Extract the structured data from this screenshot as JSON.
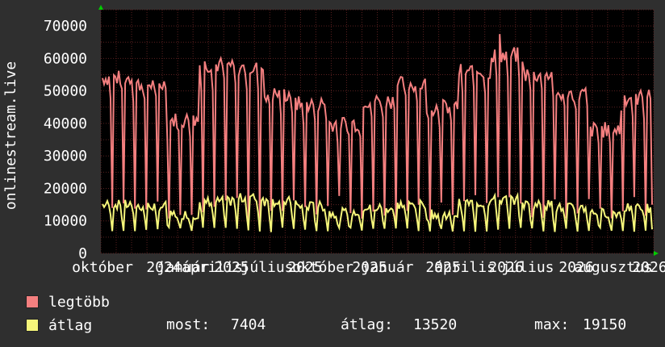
{
  "colors": {
    "background": "#2f2f2f",
    "plot_background": "#000000",
    "grid": "#5a2020",
    "series_max": "#f47f7f",
    "series_avg": "#f5f57a",
    "axis_arrow": "#00cc00",
    "text": "#ffffff"
  },
  "legend": {
    "max_label": "legtöbb",
    "avg_label": "átlag",
    "stats": {
      "now_label": "most:",
      "now_value": "7404",
      "avg_label": "átlag:",
      "avg_value": "13520",
      "max_label": "max:",
      "max_value": "19150"
    }
  },
  "chart_data": {
    "type": "line",
    "ylabel": "onlinestream.live",
    "ylim": [
      0,
      75000
    ],
    "yticks": [
      "0",
      "10000",
      "20000",
      "30000",
      "40000",
      "50000",
      "60000",
      "70000"
    ],
    "xtick_labels": [
      "október",
      "2024",
      "január",
      "április",
      "2025",
      "július",
      "2025",
      "október",
      "2025",
      "január",
      "2025",
      "április",
      "2026",
      "július",
      "2026",
      "augusztus",
      "2026"
    ],
    "grid": true,
    "series": [
      {
        "name": "legtöbb",
        "approx_range": [
          10000,
          67500
        ],
        "segments_level": [
          54000,
          52000,
          41000,
          58000,
          57000,
          49000,
          46000,
          40000,
          47000,
          52000,
          45000,
          56000,
          61000,
          55000,
          49000,
          38000,
          48000
        ]
      },
      {
        "name": "átlag",
        "approx_range": [
          5000,
          19150
        ],
        "segments_level": [
          15000,
          14500,
          12000,
          16000,
          17000,
          16000,
          14500,
          12500,
          14000,
          15000,
          12000,
          15500,
          16500,
          15000,
          14000,
          12500,
          14000
        ]
      }
    ]
  }
}
